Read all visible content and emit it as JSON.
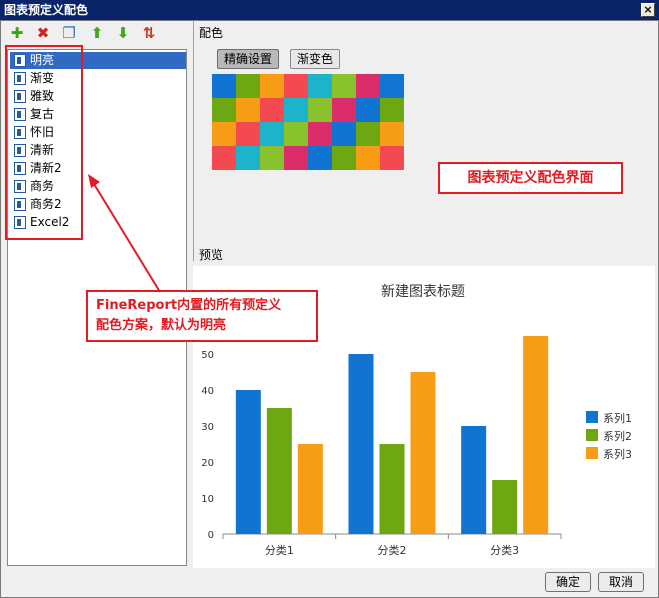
{
  "window": {
    "title": "图表预定义配色",
    "close": "×"
  },
  "toolbar": [
    {
      "name": "add-icon",
      "glyph": "✚",
      "color": "#3aa315"
    },
    {
      "name": "delete-icon",
      "glyph": "✖",
      "color": "#d0221b"
    },
    {
      "name": "copy-icon",
      "glyph": "❐",
      "color": "#3b78c2"
    },
    {
      "name": "move-up-icon",
      "glyph": "⬆",
      "color": "#45a51b"
    },
    {
      "name": "move-down-icon",
      "glyph": "⬇",
      "color": "#45a51b"
    },
    {
      "name": "sort-icon",
      "glyph": "⇅",
      "color": "#c23b22"
    }
  ],
  "schemes": [
    "明亮",
    "渐变",
    "雅致",
    "复古",
    "怀旧",
    "清新",
    "清新2",
    "商务",
    "商务2",
    "Excel2"
  ],
  "selected_index": 0,
  "color_section": {
    "label": "配色",
    "tabs": [
      "精确设置",
      "渐变色"
    ],
    "active_tab": 0,
    "palette": [
      "#1274d2",
      "#6da711",
      "#f79d15",
      "#f34950",
      "#1cb3cb",
      "#88c32d",
      "#db2d6a",
      "#1275d3",
      "#6fa711",
      "#f79c17"
    ],
    "rows": [
      [
        "#1274d2",
        "#6da711",
        "#f79d15",
        "#f34950",
        "#1cb3cb",
        "#88c32d",
        "#db2d6a",
        "#1275d3"
      ],
      [
        "#6da711",
        "#f79d15",
        "#f34950",
        "#1cb3cb",
        "#88c32d",
        "#db2d6a",
        "#1274d2",
        "#6da711"
      ],
      [
        "#f79d15",
        "#f34950",
        "#1cb3cb",
        "#88c32d",
        "#db2d6a",
        "#1274d2",
        "#6da711",
        "#f79d15"
      ],
      [
        "#f34950",
        "#1cb3cb",
        "#88c32d",
        "#db2d6a",
        "#1274d2",
        "#6da711",
        "#f79d15",
        "#f34950"
      ]
    ]
  },
  "annotations": {
    "interface": "图表预定义配色界面",
    "builtin_line1": "FineReport内置的所有预定义",
    "builtin_line2": "配色方案，默认为明亮"
  },
  "preview_section": {
    "label": "预览"
  },
  "chart_data": {
    "type": "bar",
    "title": "新建图表标题",
    "categories": [
      "分类1",
      "分类2",
      "分类3"
    ],
    "series": [
      {
        "name": "系列1",
        "values": [
          40,
          50,
          30
        ],
        "color": "#1274d2"
      },
      {
        "name": "系列2",
        "values": [
          35,
          25,
          15
        ],
        "color": "#6da711"
      },
      {
        "name": "系列3",
        "values": [
          25,
          45,
          55
        ],
        "color": "#f79d15"
      }
    ],
    "ylim": [
      0,
      50
    ],
    "yticks": [
      0,
      10,
      20,
      30,
      40,
      50
    ],
    "legend": "right",
    "grid": false
  },
  "buttons": {
    "ok": "确定",
    "cancel": "取消"
  }
}
